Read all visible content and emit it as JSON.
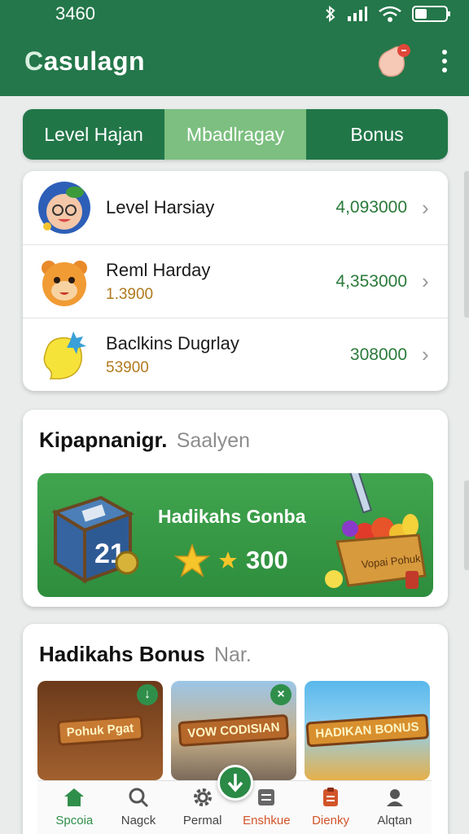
{
  "status_bar": {
    "time": "3460"
  },
  "app": {
    "title_first": "C",
    "title_rest": "asulagn"
  },
  "tabs": [
    {
      "label": "Level Hajan",
      "active": false
    },
    {
      "label": "Mbadlragay",
      "active": true
    },
    {
      "label": "Bonus",
      "active": false
    }
  ],
  "leaderboard": [
    {
      "name": "Level Harsiay",
      "sub": "",
      "value": "4,093000"
    },
    {
      "name": "Reml Harday",
      "sub": "1.3900",
      "value": "4,353000"
    },
    {
      "name": "Baclkins Dugrlay",
      "sub": "53900",
      "value": "308000"
    }
  ],
  "promo": {
    "title": "Kipapnanigr.",
    "title_muted": "Saalyen",
    "banner_title": "Hadikahs Gonba",
    "banner_amount": "300",
    "box_number": "21",
    "crate_text": "Vopai Pohuk"
  },
  "bonus_section": {
    "title": "Hadikahs Bonus",
    "title_muted": "Nar.",
    "tiles": [
      {
        "tag": "Pohuk Pgat"
      },
      {
        "tag": "VOW CODISIAN"
      },
      {
        "tag": "HADIKAN BONUS"
      }
    ]
  },
  "bottom_nav": [
    {
      "label": "Spcoia",
      "icon": "home-icon",
      "state": "active"
    },
    {
      "label": "Nagck",
      "icon": "search-icon",
      "state": ""
    },
    {
      "label": "Permal",
      "icon": "gear-icon",
      "state": ""
    },
    {
      "label": "Enshkue",
      "icon": "list-icon",
      "state": "hot"
    },
    {
      "label": "Dienky",
      "icon": "clipboard-icon",
      "state": "hot"
    },
    {
      "label": "Alqtan",
      "icon": "profile-icon",
      "state": ""
    }
  ],
  "colors": {
    "primary": "#24774a",
    "active_tab": "#7cbf80",
    "value_green": "#2a7a3a",
    "sub_gold": "#b07a1e",
    "accent_orange": "#d2542a"
  }
}
